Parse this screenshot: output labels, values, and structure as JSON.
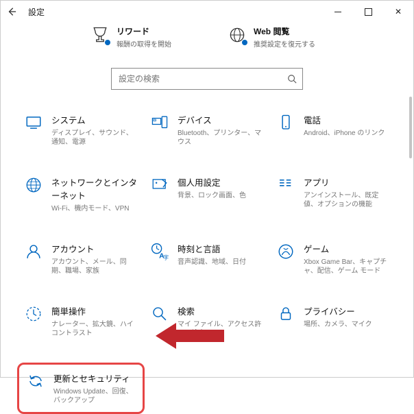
{
  "window": {
    "title": "設定"
  },
  "top": {
    "rewards": {
      "title": "リワード",
      "desc": "報酬の取得を開始"
    },
    "web": {
      "title": "Web 閲覧",
      "desc": "推奨設定を復元する"
    }
  },
  "search": {
    "placeholder": "設定の検索"
  },
  "categories": {
    "system": {
      "title": "システム",
      "desc": "ディスプレイ、サウンド、通知、電源"
    },
    "devices": {
      "title": "デバイス",
      "desc": "Bluetooth、プリンター、マウス"
    },
    "phone": {
      "title": "電話",
      "desc": "Android、iPhone のリンク"
    },
    "network": {
      "title": "ネットワークとインターネット",
      "desc": "Wi-Fi、機内モード、VPN"
    },
    "personal": {
      "title": "個人用設定",
      "desc": "背景、ロック画面、色"
    },
    "apps": {
      "title": "アプリ",
      "desc": "アンインストール、既定値、オプションの機能"
    },
    "accounts": {
      "title": "アカウント",
      "desc": "アカウント、メール、同期、職場、家族"
    },
    "time": {
      "title": "時刻と言語",
      "desc": "音声認識、地域、日付"
    },
    "gaming": {
      "title": "ゲーム",
      "desc": "Xbox Game Bar、キャプチャ、配信、ゲーム モード"
    },
    "ease": {
      "title": "簡単操作",
      "desc": "ナレーター、拡大鏡、ハイコントラスト"
    },
    "searchc": {
      "title": "検索",
      "desc": "マイ ファイル、アクセス許可の検索"
    },
    "privacy": {
      "title": "プライバシー",
      "desc": "場所、カメラ、マイク"
    },
    "update": {
      "title": "更新とセキュリティ",
      "desc": "Windows Update、回復、バックアップ"
    }
  }
}
